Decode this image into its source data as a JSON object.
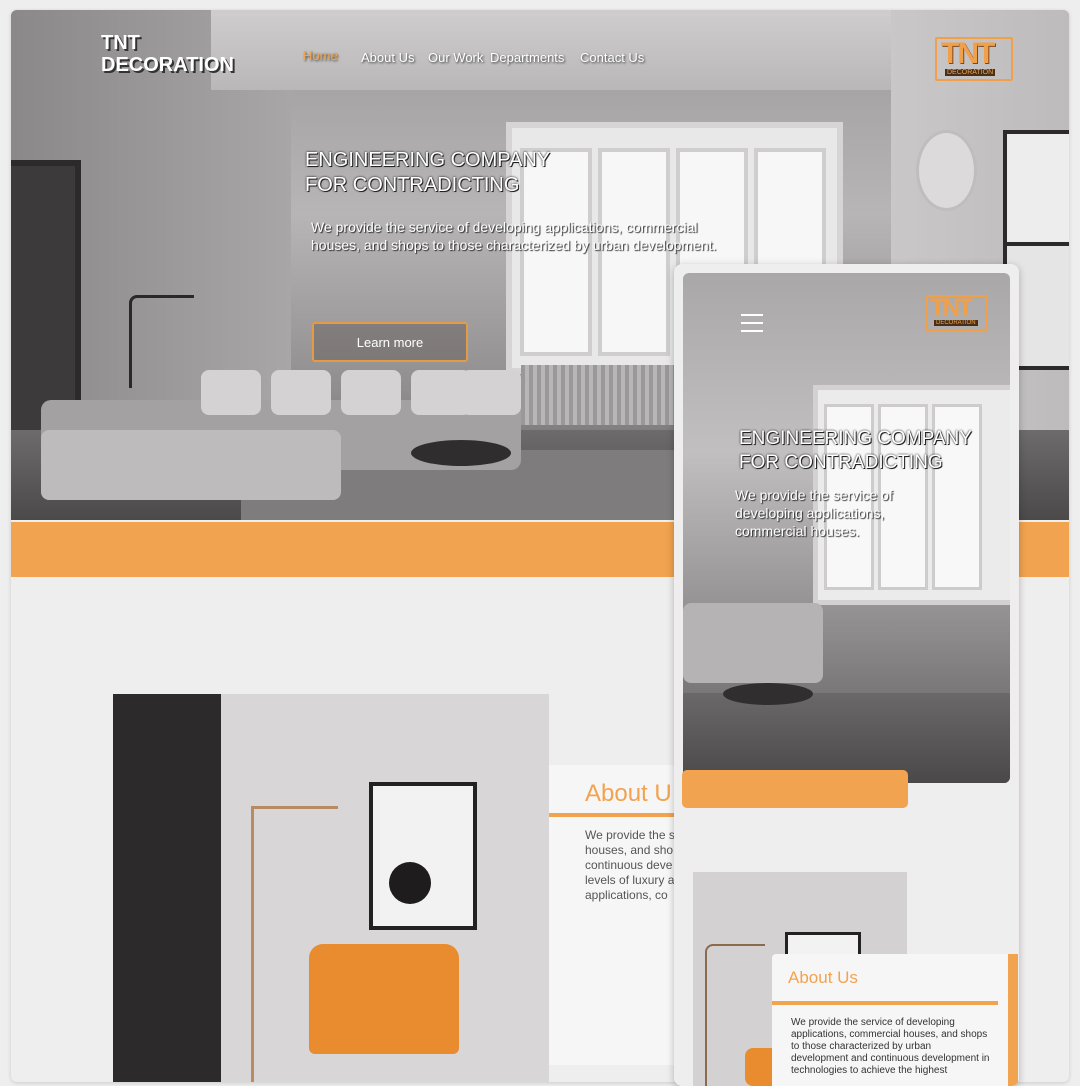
{
  "desktop": {
    "logo_text": "TNT\nDECORATION",
    "nav": [
      {
        "label": "Home",
        "active": true
      },
      {
        "label": "About Us",
        "active": false
      },
      {
        "label": "Our Work",
        "active": false
      },
      {
        "label": "Departments",
        "active": false
      },
      {
        "label": "Contact Us",
        "active": false
      }
    ],
    "brand_badge": {
      "big": "TNT",
      "small": "DECORATION"
    },
    "hero": {
      "title": "ENGINEERING COMPANY\nFOR CONTRADICTING",
      "subtitle": "We provide the service of developing applications, commercial houses, and shops to those characterized by urban development.",
      "cta_label": "Learn more"
    },
    "about": {
      "title": "About U",
      "text": "We provide the s\nhouses, and sho\ncontinuous deve\nlevels of luxury a\napplications, co"
    }
  },
  "mobile": {
    "brand_badge": {
      "big": "TNT",
      "small": "DECORATION"
    },
    "hero": {
      "title": "ENGINEERING COMPANY\nFOR CONTRADICTING",
      "subtitle": "We provide the service of developing applications, commercial houses."
    },
    "about": {
      "title": "About Us",
      "text": "We provide the service of developing applications, commercial houses, and shops to those characterized by urban development and continuous development in technologies to achieve the highest"
    }
  },
  "colors": {
    "accent": "#f1a34f",
    "active_nav": "#f5a64a"
  }
}
